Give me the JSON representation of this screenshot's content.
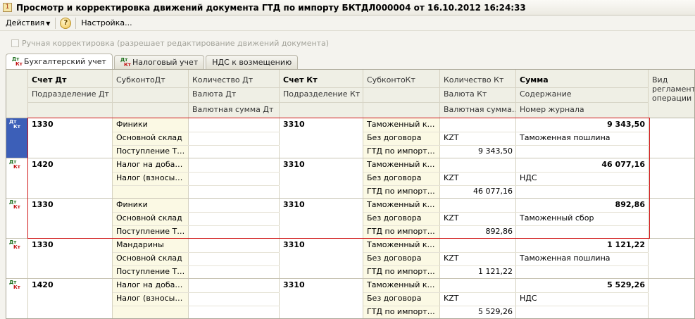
{
  "window": {
    "title": "Просмотр и корректировка движений документа ГТД по импорту БКТДЛ000004 от 16.10.2012 16:24:33"
  },
  "toolbar": {
    "actions": "Действия",
    "help": "?",
    "settings": "Настройка..."
  },
  "manual_correction": "Ручная корректировка (разрешает редактирование движений документа)",
  "tabs": [
    {
      "label": "Бухгалтерский учет",
      "active": true
    },
    {
      "label": "Налоговый учет",
      "active": false
    },
    {
      "label": "НДС к возмещению",
      "active": false
    }
  ],
  "icon_text": {
    "dt": "Дт",
    "kt": "Кт"
  },
  "header": {
    "schet_dt": "Счет Дт",
    "podr_dt": "Подразделение Дт",
    "subkonto_dt": "СубконтоДт",
    "kol_dt": "Количество Дт",
    "valuta_dt": "Валюта Дт",
    "val_summa_dt": "Валютная сумма Дт",
    "schet_kt": "Счет Кт",
    "podr_kt": "Подразделение Кт",
    "subkonto_kt": "СубконтоКт",
    "kol_kt": "Количество Кт",
    "valuta_kt": "Валюта Кт",
    "val_summa_kt": "Валютная сумма...",
    "summa": "Сумма",
    "soderzhanie": "Содержание",
    "nomer_zhurnala": "Номер журнала",
    "vid_reglament": "Вид регламентной операции"
  },
  "rows": [
    {
      "dt": "1330",
      "sub_dt": [
        "Финики",
        "Основной склад",
        "Поступление ТМ..."
      ],
      "kt": "3310",
      "sub_kt": [
        "Таможенный ком...",
        "Без договора",
        "ГТД по импорту ..."
      ],
      "valuta_kt": "KZT",
      "val_summa_kt": "9 343,50",
      "summa": "9 343,50",
      "soderzhanie": "Таможенная пошлина",
      "selected": true
    },
    {
      "dt": "1420",
      "sub_dt": [
        "Налог на добавл...",
        "Налог (взносы): н...",
        ""
      ],
      "kt": "3310",
      "sub_kt": [
        "Таможенный ком...",
        "Без договора",
        "ГТД по импорту ..."
      ],
      "valuta_kt": "KZT",
      "val_summa_kt": "46 077,16",
      "summa": "46 077,16",
      "soderzhanie": "НДС",
      "selected": false
    },
    {
      "dt": "1330",
      "sub_dt": [
        "Финики",
        "Основной склад",
        "Поступление ТМ..."
      ],
      "kt": "3310",
      "sub_kt": [
        "Таможенный ком...",
        "Без договора",
        "ГТД по импорту ..."
      ],
      "valuta_kt": "KZT",
      "val_summa_kt": "892,86",
      "summa": "892,86",
      "soderzhanie": "Таможенный сбор",
      "selected": false
    },
    {
      "dt": "1330",
      "sub_dt": [
        "Мандарины",
        "Основной склад",
        "Поступление ТМ..."
      ],
      "kt": "3310",
      "sub_kt": [
        "Таможенный ком...",
        "Без договора",
        "ГТД по импорту ..."
      ],
      "valuta_kt": "KZT",
      "val_summa_kt": "1 121,22",
      "summa": "1 121,22",
      "soderzhanie": "Таможенная пошлина",
      "selected": false
    },
    {
      "dt": "1420",
      "sub_dt": [
        "Налог на добавл...",
        "Налог (взносы): н...",
        ""
      ],
      "kt": "3310",
      "sub_kt": [
        "Таможенный ком...",
        "Без договора",
        "ГТД по импорту ..."
      ],
      "valuta_kt": "KZT",
      "val_summa_kt": "5 529,26",
      "summa": "5 529,26",
      "soderzhanie": "НДС",
      "selected": false
    }
  ]
}
